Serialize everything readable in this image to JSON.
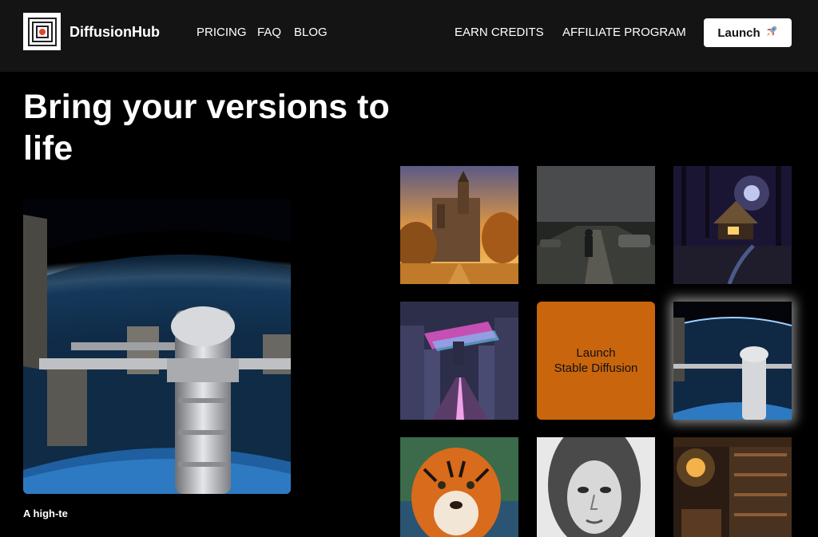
{
  "header": {
    "brand": "DiffusionHub",
    "logo_icon": "concentric-squares-logo",
    "nav_left": [
      "PRICING",
      "FAQ",
      "BLOG"
    ],
    "nav_right": [
      "EARN CREDITS",
      "AFFILIATE PROGRAM"
    ],
    "launch_label": "Launch",
    "launch_icon": "rocket-icon"
  },
  "hero": {
    "title": "Bring your versions to life",
    "caption": "A high-te"
  },
  "grid": {
    "launch_tile_line1": "Launch",
    "launch_tile_line2": "Stable Diffusion",
    "images": [
      "castle-sunset-image",
      "road-walker-storm-image",
      "forest-cottage-night-image",
      "neon-city-ship-image",
      "space-station-thumb-image",
      "tiger-portrait-image",
      "woman-pencil-sketch-image",
      "old-library-interior-image"
    ]
  },
  "colors": {
    "header_bg": "#141414",
    "page_bg": "#000000",
    "accent_orange": "#c9650d"
  }
}
